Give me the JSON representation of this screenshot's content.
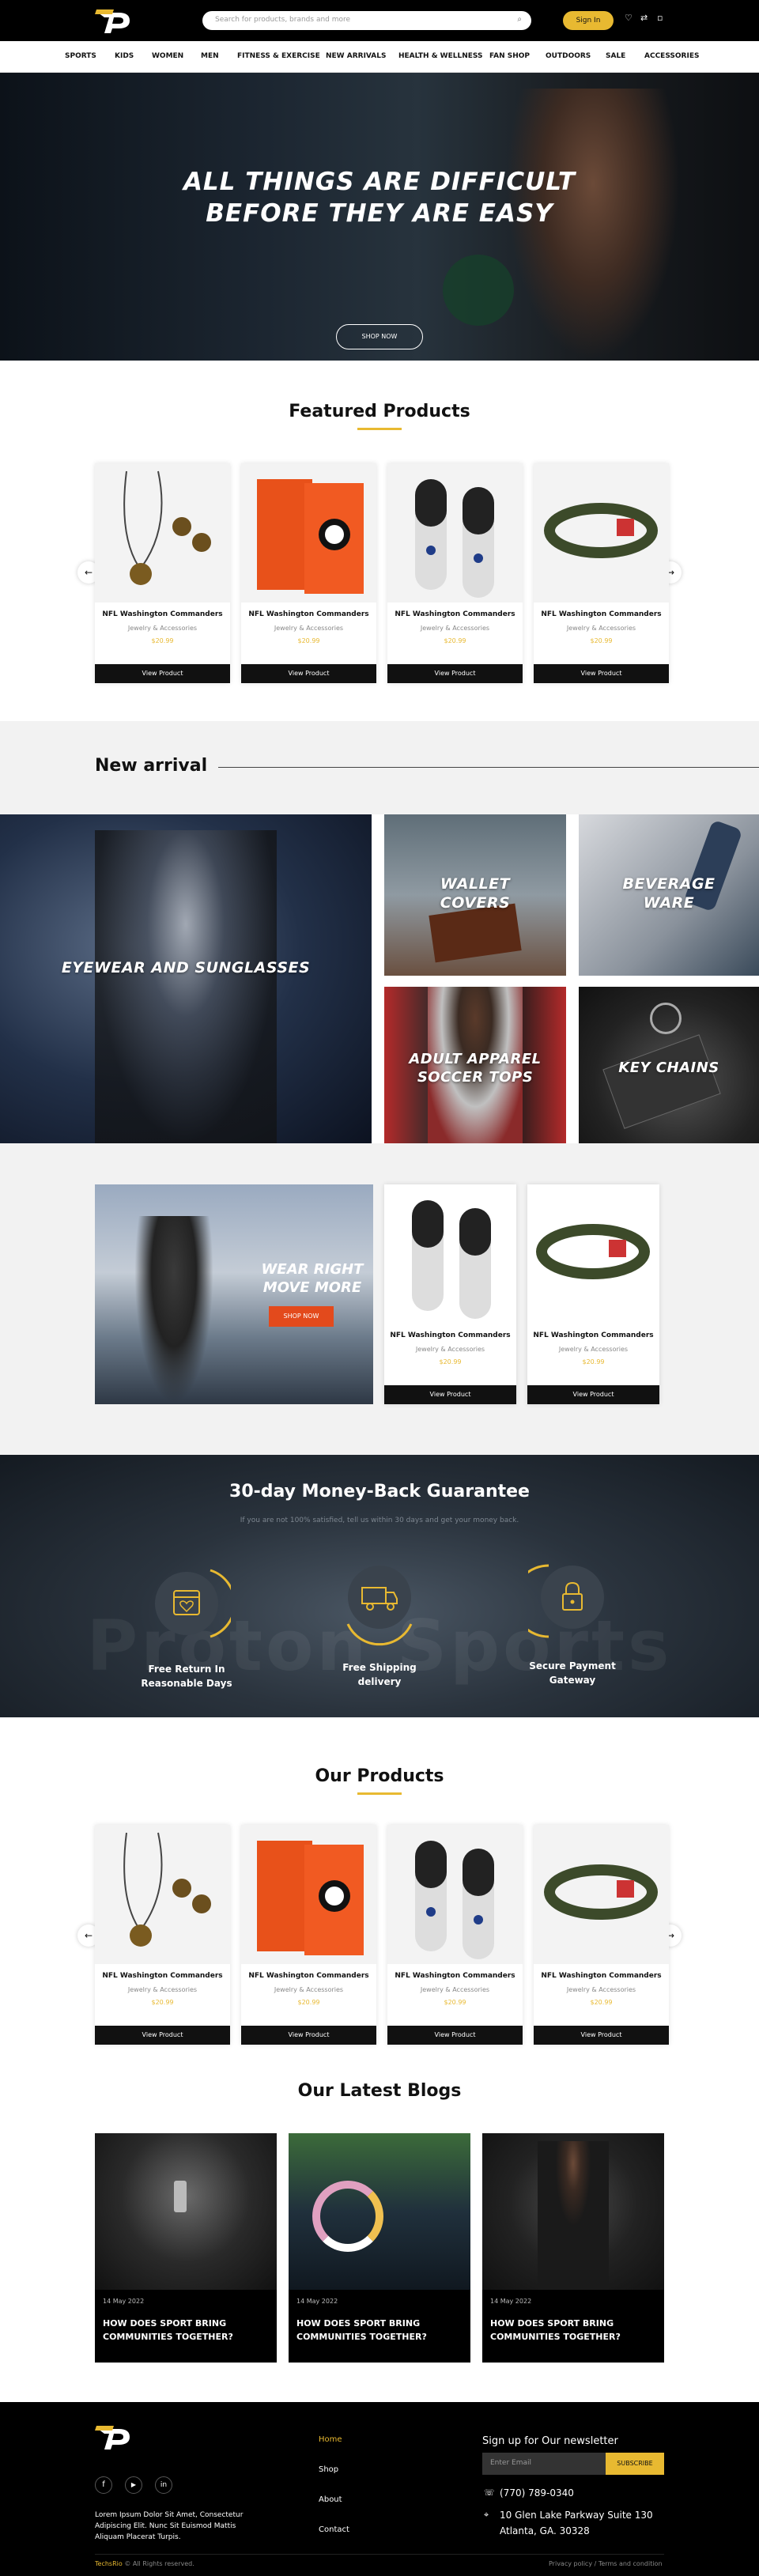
{
  "header": {
    "search_placeholder": "Search for products, brands and more",
    "signin_label": "Sign In"
  },
  "nav": [
    "SPORTS",
    "KIDS",
    "WOMEN",
    "MEN",
    "FITNESS & EXERCISE",
    "NEW ARRIVALS",
    "HEALTH & WELLNESS",
    "FAN SHOP",
    "OUTDOORS",
    "SALE",
    "ACCESSORIES"
  ],
  "hero": {
    "line1": "ALL THINGS ARE DIFFICULT",
    "line2": "BEFORE THEY ARE EASY",
    "cta": "SHOP NOW"
  },
  "featured": {
    "title": "Featured Products",
    "products": [
      {
        "name": "NFL Washington Commanders",
        "category": "Jewelry & Accessories",
        "price": "$20.99",
        "button": "View Product"
      },
      {
        "name": "NFL Washington Commanders",
        "category": "Jewelry & Accessories",
        "price": "$20.99",
        "button": "View Product"
      },
      {
        "name": "NFL Washington Commanders",
        "category": "Jewelry & Accessories",
        "price": "$20.99",
        "button": "View Product"
      },
      {
        "name": "NFL Washington Commanders",
        "category": "Jewelry & Accessories",
        "price": "$20.99",
        "button": "View Product"
      }
    ]
  },
  "new_arrival": {
    "title": "New arrival",
    "tiles": [
      "EYEWEAR AND SUNGLASSES",
      "WALLET COVERS",
      "BEVERAGE WARE",
      "ADULT APPAREL SOCCER TOPS",
      "KEY CHAINS"
    ]
  },
  "promo": {
    "line1": "WEAR RIGHT",
    "line2": "MOVE MORE",
    "cta": "SHOP NOW",
    "products": [
      {
        "name": "NFL Washington Commanders",
        "category": "Jewelry & Accessories",
        "price": "$20.99",
        "button": "View Product"
      },
      {
        "name": "NFL Washington Commanders",
        "category": "Jewelry & Accessories",
        "price": "$20.99",
        "button": "View Product"
      }
    ]
  },
  "guarantee": {
    "title": "30-day Money-Back Guarantee",
    "subtitle": "If you are not 100% satisfied, tell us within 30 days and get your money back.",
    "watermark": "Proton Sports",
    "features": [
      {
        "line1": "Free Return In",
        "line2": "Reasonable Days",
        "icon": "calendar-heart-icon"
      },
      {
        "line1": "Free Shipping",
        "line2": "delivery",
        "icon": "truck-icon"
      },
      {
        "line1": "Secure Payment",
        "line2": "Gateway",
        "icon": "lock-icon"
      }
    ]
  },
  "our_products": {
    "title": "Our Products",
    "products": [
      {
        "name": "NFL Washington Commanders",
        "category": "Jewelry & Accessories",
        "price": "$20.99",
        "button": "View Product"
      },
      {
        "name": "NFL Washington Commanders",
        "category": "Jewelry & Accessories",
        "price": "$20.99",
        "button": "View Product"
      },
      {
        "name": "NFL Washington Commanders",
        "category": "Jewelry & Accessories",
        "price": "$20.99",
        "button": "View Product"
      },
      {
        "name": "NFL Washington Commanders",
        "category": "Jewelry & Accessories",
        "price": "$20.99",
        "button": "View Product"
      }
    ]
  },
  "blogs": {
    "title": "Our Latest Blogs",
    "items": [
      {
        "date": "14 May 2022",
        "title": "HOW DOES SPORT BRING COMMUNITIES TOGETHER?"
      },
      {
        "date": "14 May 2022",
        "title": "HOW DOES SPORT BRING COMMUNITIES TOGETHER?"
      },
      {
        "date": "14 May 2022",
        "title": "HOW DOES SPORT BRING COMMUNITIES TOGETHER?"
      }
    ]
  },
  "footer": {
    "about": "Lorem Ipsum Dolor Sit Amet, Consectetur Adipiscing Elit. Nunc Sit Euismod Mattis Aliquam Placerat Turpis.",
    "links": [
      "Home",
      "Shop",
      "About",
      "Contact"
    ],
    "newsletter_title": "Sign up for Our newsletter",
    "email_placeholder": "Enter Email",
    "subscribe": "SUBSCRIBE",
    "phone": "(770) 789-0340",
    "address1": "10 Glen Lake Parkway Suite 130",
    "address2": "Atlanta, GA. 30328",
    "brand": "TechsRio",
    "copyright": "© All Rights reserved.",
    "policy": "Privacy policy / Terms and condition"
  },
  "colors": {
    "accent": "#e8b931",
    "dark": "#000000"
  }
}
